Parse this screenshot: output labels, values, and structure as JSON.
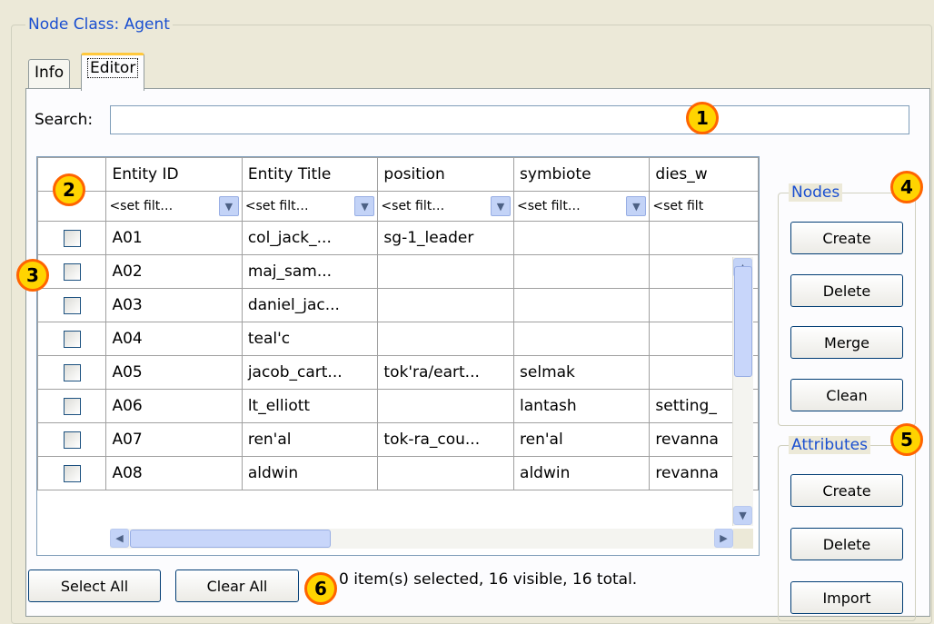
{
  "window": {
    "group_title": "Node Class: Agent"
  },
  "tabs": [
    {
      "label": "Info",
      "active": false
    },
    {
      "label": "Editor",
      "active": true
    }
  ],
  "search": {
    "label": "Search:",
    "value": "",
    "placeholder": ""
  },
  "grid": {
    "columns": [
      "Entity ID",
      "Entity Title",
      "position",
      "symbiote",
      "dies_w"
    ],
    "filter_text": [
      "<set filt…",
      "<set filt…",
      "<set filt…",
      "<set filt…",
      "<set filt"
    ],
    "rows": [
      {
        "checked": false,
        "cells": [
          "A01",
          "col_jack_...",
          "sg-1_leader",
          "",
          ""
        ]
      },
      {
        "checked": false,
        "cells": [
          "A02",
          "maj_sam...",
          "",
          "",
          ""
        ]
      },
      {
        "checked": false,
        "cells": [
          "A03",
          "daniel_jac...",
          "",
          "",
          ""
        ]
      },
      {
        "checked": false,
        "cells": [
          "A04",
          "teal'c",
          "",
          "",
          ""
        ]
      },
      {
        "checked": false,
        "cells": [
          "A05",
          "jacob_cart...",
          "tok'ra/eart...",
          "selmak",
          ""
        ]
      },
      {
        "checked": false,
        "cells": [
          "A06",
          "lt_elliott",
          "",
          "lantash",
          "setting_"
        ]
      },
      {
        "checked": false,
        "cells": [
          "A07",
          "ren'al",
          "tok-ra_cou...",
          "ren'al",
          "revanna"
        ]
      },
      {
        "checked": false,
        "cells": [
          "A08",
          "aldwin",
          "",
          "aldwin",
          "revanna"
        ]
      }
    ]
  },
  "nodes": {
    "title": "Nodes",
    "buttons": [
      "Create",
      "Delete",
      "Merge",
      "Clean"
    ]
  },
  "attributes": {
    "title": "Attributes",
    "buttons": [
      "Create",
      "Delete",
      "Import"
    ]
  },
  "bottom": {
    "select_all": "Select All",
    "clear_all": "Clear All",
    "status": "0 item(s) selected, 16 visible, 16 total."
  },
  "markers": [
    "1",
    "2",
    "3",
    "4",
    "5",
    "6"
  ],
  "icons": {
    "dropdown": "chevron-down-icon",
    "scroll_up": "arrow-up-icon",
    "scroll_down": "arrow-down-icon",
    "scroll_left": "arrow-left-icon",
    "scroll_right": "arrow-right-icon"
  },
  "colors": {
    "background": "#ece9d8",
    "legend": "#1a4fd0",
    "marker_fill": "#ffd400",
    "marker_border": "#ff6400",
    "active_tab": "#ffc83c"
  }
}
